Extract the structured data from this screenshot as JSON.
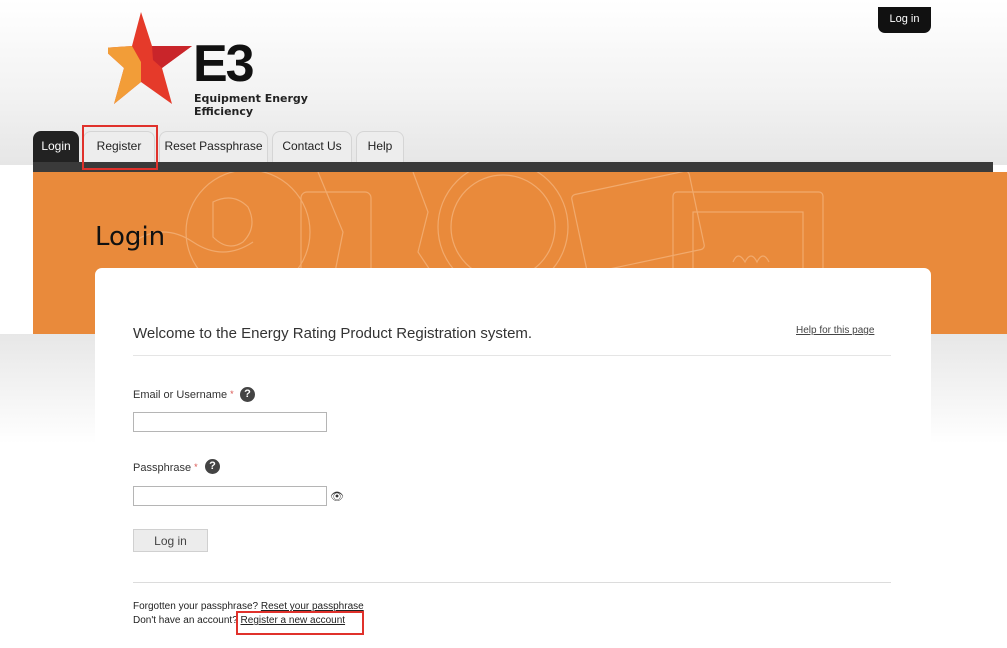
{
  "header": {
    "logo": {
      "mark": "E3",
      "line1": "Equipment Energy",
      "line2": "Efficiency"
    },
    "login_button": "Log in"
  },
  "tabs": [
    {
      "label": "Login",
      "active": true
    },
    {
      "label": "Register",
      "active": false
    },
    {
      "label": "Reset Passphrase",
      "active": false
    },
    {
      "label": "Contact Us",
      "active": false
    },
    {
      "label": "Help",
      "active": false
    }
  ],
  "page": {
    "title": "Login"
  },
  "form": {
    "welcome": "Welcome to the Energy Rating Product Registration system.",
    "help_link": "Help for this page",
    "email_label": "Email or Username",
    "passphrase_label": "Passphrase",
    "required_marker": "*",
    "help_glyph": "?",
    "email_value": "",
    "passphrase_value": "",
    "login_button": "Log in"
  },
  "footer": {
    "forgot_text": "Forgotten your passphrase?",
    "forgot_link": "Reset your passphrase",
    "no_account_text": "Don't have an account?",
    "register_link": "Register a new account"
  },
  "colors": {
    "accent_orange": "#e98a3b",
    "tab_bar": "#3a3a3a",
    "highlight_red": "#e0312b",
    "logo_red": "#e53a2a",
    "logo_yellow": "#f3a83a"
  },
  "icons": [
    "question-circle-icon",
    "eye-icon",
    "star-logo-icon"
  ]
}
